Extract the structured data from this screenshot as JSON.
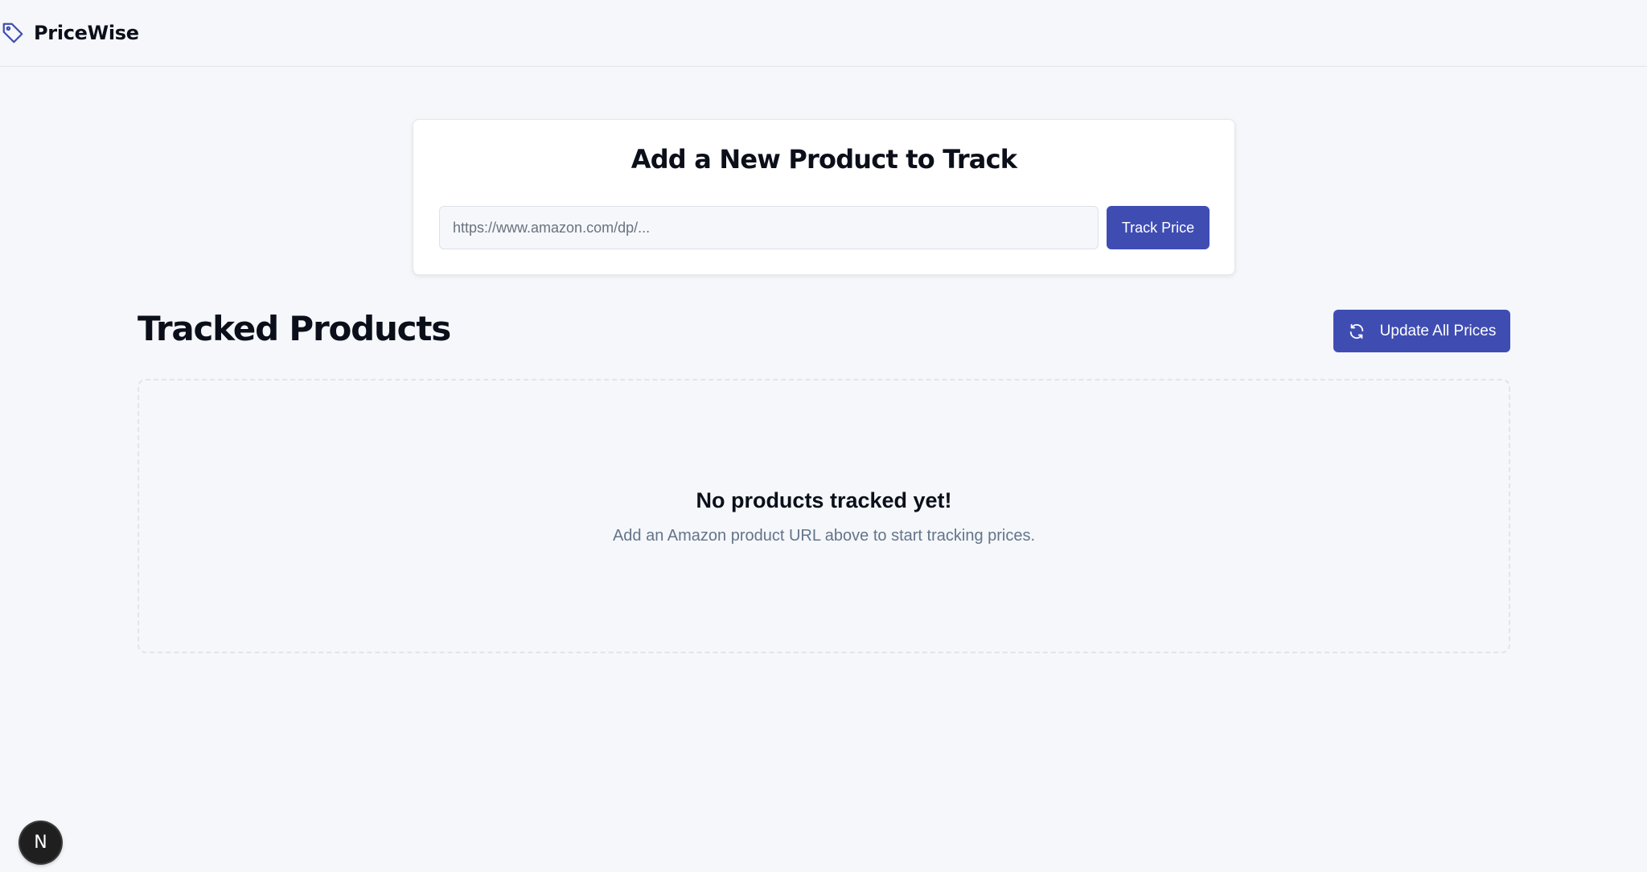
{
  "header": {
    "brand_name": "PriceWise",
    "brand_icon": "tag-icon"
  },
  "add_product": {
    "title": "Add a New Product to Track",
    "url_input": {
      "value": "",
      "placeholder": "https://www.amazon.com/dp/..."
    },
    "track_button_label": "Track Price"
  },
  "tracked": {
    "title": "Tracked Products",
    "update_button_label": "Update All Prices",
    "update_button_icon": "refresh-icon",
    "empty_state": {
      "title": "No products tracked yet!",
      "subtitle": "Add an Amazon product URL above to start tracking prices."
    }
  },
  "dev_badge": {
    "letter": "N"
  },
  "colors": {
    "accent": "#3f4db3",
    "background": "#f5f7fa",
    "muted_text": "#64748b"
  }
}
